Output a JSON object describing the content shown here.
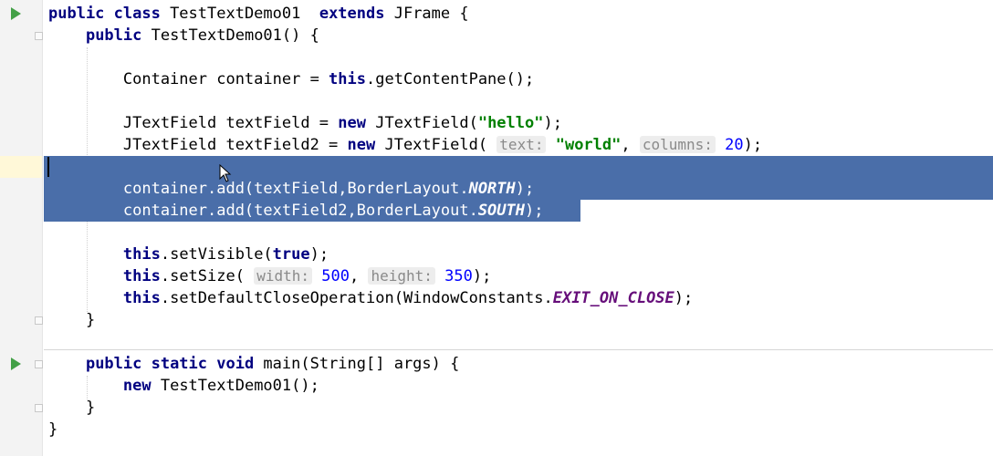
{
  "editor": {
    "lines": [
      [
        {
          "t": "public class",
          "c": "kw"
        },
        {
          "t": " TestTextDemo01  "
        },
        {
          "t": "extends",
          "c": "kw"
        },
        {
          "t": " JFrame {"
        }
      ],
      [
        {
          "t": "    "
        },
        {
          "t": "public",
          "c": "kw"
        },
        {
          "t": " TestTextDemo01() {"
        }
      ],
      [],
      [
        {
          "t": "        Container container = "
        },
        {
          "t": "this",
          "c": "kw"
        },
        {
          "t": ".getContentPane();"
        }
      ],
      [],
      [
        {
          "t": "        JTextField textField = "
        },
        {
          "t": "new",
          "c": "kw"
        },
        {
          "t": " JTextField("
        },
        {
          "t": "\"hello\"",
          "c": "str"
        },
        {
          "t": ");"
        }
      ],
      [
        {
          "t": "        JTextField textField2 = "
        },
        {
          "t": "new",
          "c": "kw"
        },
        {
          "t": " JTextField( "
        },
        {
          "t": "text:",
          "c": "hint"
        },
        {
          "t": " "
        },
        {
          "t": "\"world\"",
          "c": "str"
        },
        {
          "t": ", "
        },
        {
          "t": "columns:",
          "c": "hint"
        },
        {
          "t": " "
        },
        {
          "t": "20",
          "c": "num"
        },
        {
          "t": ");"
        }
      ],
      [],
      [
        {
          "t": "        container.add(textField,BorderLayout."
        },
        {
          "t": "NORTH",
          "c": "konst"
        },
        {
          "t": ");"
        }
      ],
      [
        {
          "t": "        container.add(textField2,BorderLayout."
        },
        {
          "t": "SOUTH",
          "c": "konst"
        },
        {
          "t": ");"
        }
      ],
      [],
      [
        {
          "t": "        "
        },
        {
          "t": "this",
          "c": "kw"
        },
        {
          "t": ".setVisible("
        },
        {
          "t": "true",
          "c": "kw"
        },
        {
          "t": ");"
        }
      ],
      [
        {
          "t": "        "
        },
        {
          "t": "this",
          "c": "kw"
        },
        {
          "t": ".setSize( "
        },
        {
          "t": "width:",
          "c": "hint"
        },
        {
          "t": " "
        },
        {
          "t": "500",
          "c": "num"
        },
        {
          "t": ", "
        },
        {
          "t": "height:",
          "c": "hint"
        },
        {
          "t": " "
        },
        {
          "t": "350",
          "c": "num"
        },
        {
          "t": ");"
        }
      ],
      [
        {
          "t": "        "
        },
        {
          "t": "this",
          "c": "kw"
        },
        {
          "t": ".setDefaultCloseOperation(WindowConstants."
        },
        {
          "t": "EXIT_ON_CLOSE",
          "c": "konst"
        },
        {
          "t": ");"
        }
      ],
      [
        {
          "t": "    }"
        }
      ],
      [],
      [
        {
          "t": "    "
        },
        {
          "t": "public static void",
          "c": "kw"
        },
        {
          "t": " main(String[] args) {"
        }
      ],
      [
        {
          "t": "        "
        },
        {
          "t": "new",
          "c": "kw"
        },
        {
          "t": " TestTextDemo01();"
        }
      ],
      [
        {
          "t": "    }"
        }
      ],
      [
        {
          "t": "}"
        }
      ]
    ],
    "selected_lines": [
      7,
      8,
      9
    ],
    "colors": {
      "keyword": "#000080",
      "string": "#008000",
      "number": "#0000ff",
      "constant": "#660e7a",
      "selection": "#4a6ea9",
      "run_icon": "#43a047"
    }
  },
  "gutter": {
    "run_icon_lines": [
      0,
      16
    ],
    "fold_icon_lines": [
      1,
      14,
      16,
      18
    ]
  }
}
